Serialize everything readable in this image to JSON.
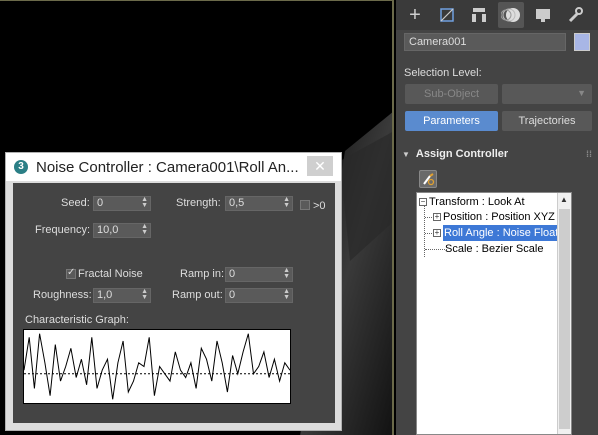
{
  "panel": {
    "tabs": [
      {
        "icon": "plus-icon",
        "label": "+"
      },
      {
        "icon": "modify-icon",
        "label": "▢"
      },
      {
        "icon": "hierarchy-icon",
        "label": "⊓"
      },
      {
        "icon": "motion-icon",
        "label": "◐"
      },
      {
        "icon": "display-icon",
        "label": "▭"
      },
      {
        "icon": "utilities-icon",
        "label": "⚒"
      }
    ],
    "object_name": "Camera001",
    "object_color": "#a8b6e6",
    "selection_level_label": "Selection Level:",
    "subobject_label": "Sub-Object",
    "subobject_dropdown_arrow": "▼",
    "parameters_label": "Parameters",
    "trajectories_label": "Trajectories",
    "rollout_title": "Assign Controller",
    "rollout_triangle": "▼",
    "rollout_grip": "⁞⁞",
    "tree": [
      {
        "label": "Transform : Look At",
        "expander": "−",
        "selected": false
      },
      {
        "label": "Position : Position XYZ",
        "expander": "+",
        "selected": false
      },
      {
        "label": "Roll Angle : Noise Float",
        "expander": "+",
        "selected": true
      },
      {
        "label": "Scale : Bezier Scale",
        "expander": "",
        "selected": false
      }
    ],
    "scroll_up": "▲"
  },
  "dialog": {
    "icon_text": "3",
    "title": "Noise Controller : Camera001\\Roll An...",
    "close_glyph": "✕",
    "seed_label": "Seed:",
    "seed_value": "0",
    "strength_label": "Strength:",
    "strength_value": "0,5",
    "gt0_label": ">0",
    "frequency_label": "Frequency:",
    "frequency_value": "10,0",
    "fractal_label": "Fractal Noise",
    "fractal_checked": true,
    "rampin_label": "Ramp in:",
    "rampin_value": "0",
    "roughness_label": "Roughness:",
    "roughness_value": "1,0",
    "rampout_label": "Ramp out:",
    "rampout_value": "0",
    "graph_label": "Characteristic Graph:",
    "spinner_arrows": "▲\n▼"
  },
  "graph_samples": [
    0.45,
    0.9,
    0.2,
    0.95,
    0.55,
    0.1,
    0.8,
    0.3,
    0.5,
    0.75,
    0.35,
    0.6,
    0.25,
    0.9,
    0.2,
    0.45,
    0.6,
    0.05,
    0.55,
    0.85,
    0.15,
    0.3,
    0.55,
    0.5,
    0.9,
    0.1,
    0.5,
    0.4,
    0.3,
    0.7,
    0.45,
    0.35,
    0.55,
    0.2,
    0.75,
    0.6,
    0.3,
    0.85,
    0.55,
    0.15,
    0.65,
    0.4,
    0.7,
    0.95,
    0.4,
    0.5,
    0.7,
    0.35,
    0.6,
    0.3,
    0.55,
    0.45
  ]
}
